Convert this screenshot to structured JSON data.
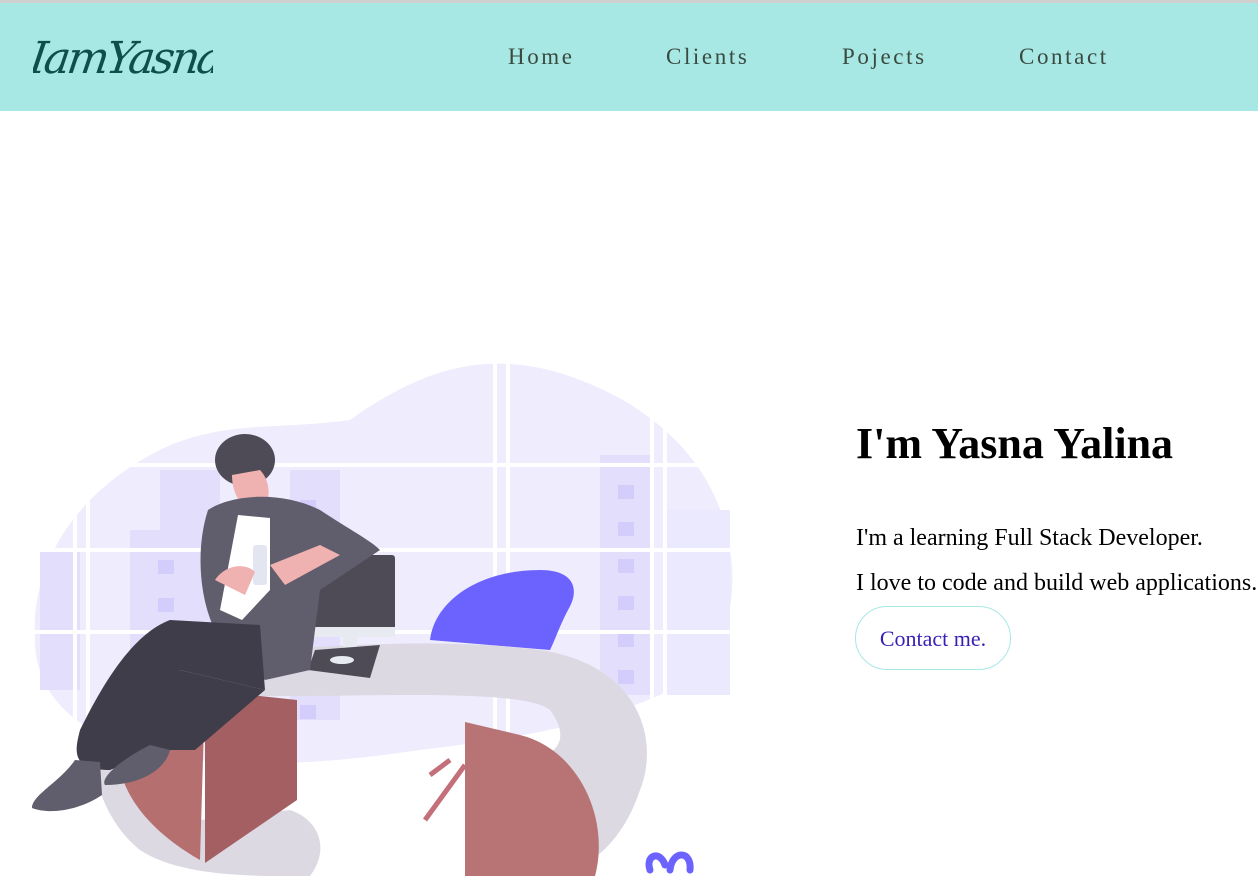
{
  "brand": {
    "logo_text": "IamYasna"
  },
  "nav": {
    "items": [
      {
        "label": "Home"
      },
      {
        "label": "Clients"
      },
      {
        "label": "Pojects"
      },
      {
        "label": "Contact"
      }
    ]
  },
  "hero": {
    "title": "I'm Yasna Yalina",
    "line1": "I'm a learning Full Stack Developer.",
    "line2": "I love to code and build web applications.",
    "cta_label": "Contact me."
  },
  "colors": {
    "navbar_bg": "#a8e8e4",
    "nav_text": "#3a4a40",
    "logo_text": "#0d4f4a",
    "cta_text": "#3a1fb5",
    "cta_border": "#a8e8e4",
    "illustration_accent": "#6c63ff",
    "desk_color": "#b56f6f"
  }
}
